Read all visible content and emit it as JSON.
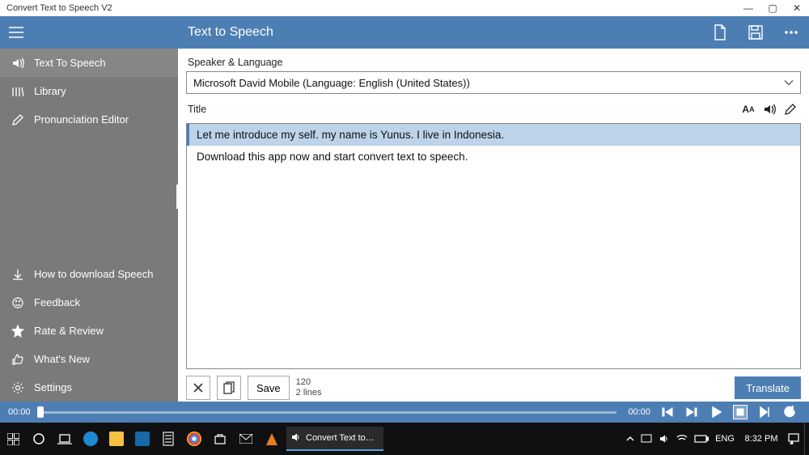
{
  "window": {
    "title": "Convert Text to Speech V2"
  },
  "appbar": {
    "page_title": "Text to Speech"
  },
  "sidebar": {
    "items": [
      {
        "label": "Text To Speech"
      },
      {
        "label": "Library"
      },
      {
        "label": "Pronunciation Editor"
      }
    ],
    "footer": [
      {
        "label": "How to download Speech"
      },
      {
        "label": "Feedback"
      },
      {
        "label": "Rate & Review"
      },
      {
        "label": "What's New"
      },
      {
        "label": "Settings"
      }
    ]
  },
  "main": {
    "speaker_label": "Speaker & Language",
    "speaker_value": "Microsoft David Mobile (Language: English (United States))",
    "title_label": "Title",
    "lines": [
      "Let me introduce my self. my name is Yunus. I live in Indonesia.",
      "Download this app now and start convert text to speech."
    ],
    "save_label": "Save",
    "char_count": "120",
    "line_count": "2 lines",
    "translate_label": "Translate"
  },
  "player": {
    "time_left": "00:00",
    "time_right": "00:00"
  },
  "taskbar": {
    "active_app": "Convert Text to Speec...",
    "lang": "ENG",
    "clock": "8:32 PM"
  }
}
